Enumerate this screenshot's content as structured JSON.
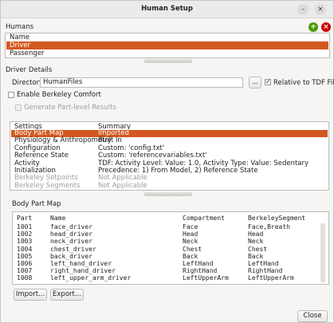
{
  "window": {
    "title": "Human Setup",
    "minimize_icon": "minimize-icon",
    "close_icon": "close-icon"
  },
  "humans": {
    "label": "Humans",
    "add_icon": "plus-icon",
    "remove_icon": "x-icon",
    "header": "Name",
    "items": [
      "Driver",
      "Passenger"
    ],
    "selected": "Driver",
    "colors": {
      "add": "#4e9a06",
      "remove": "#cc0000",
      "selection": "#d2581f"
    }
  },
  "details": {
    "label": "Driver Details",
    "directory_label": "Directory:",
    "directory_value": "HumanFiles",
    "browse_label": "...",
    "relative_label": "Relative to TDF File",
    "relative_checked": true,
    "berkeley_label": "Enable Berkeley Comfort",
    "berkeley_checked": false,
    "generate_label": "Generate Part-level Results",
    "generate_checked": false
  },
  "settings": {
    "headers": [
      "Settings",
      "Summary"
    ],
    "rows": [
      {
        "setting": "Body Part Map",
        "summary": "Imported",
        "selected": true,
        "disabled": false
      },
      {
        "setting": "Physiology & Anthropometry",
        "summary": "Built In",
        "selected": false,
        "disabled": false
      },
      {
        "setting": "Configuration",
        "summary": "Custom: 'config.txt'",
        "selected": false,
        "disabled": false
      },
      {
        "setting": "Reference State",
        "summary": "Custom: 'referencevariables.txt'",
        "selected": false,
        "disabled": false
      },
      {
        "setting": "Activity",
        "summary": "TDF: Activity Level: Value: 1.0, Activity Type: Value: Sedentary",
        "selected": false,
        "disabled": false
      },
      {
        "setting": "Initialization",
        "summary": "Precedence: 1) From Model, 2) Reference State",
        "selected": false,
        "disabled": false
      },
      {
        "setting": "Berkeley Setpoints",
        "summary": "Not Applicable",
        "selected": false,
        "disabled": true
      },
      {
        "setting": "Berkeley Segments",
        "summary": "Not Applicable",
        "selected": false,
        "disabled": true
      }
    ]
  },
  "body_part_map": {
    "label": "Body Part Map",
    "headers": [
      "Part",
      "Name",
      "Compartment",
      "BerkeleySegment"
    ],
    "rows": [
      [
        "1001",
        "face_driver",
        "Face",
        "Face,Breath"
      ],
      [
        "1002",
        "head_driver",
        "Head",
        "Head"
      ],
      [
        "1003",
        "neck_driver",
        "Neck",
        "Neck"
      ],
      [
        "1004",
        "chest_driver",
        "Chest",
        "Chest"
      ],
      [
        "1005",
        "back_driver",
        "Back",
        "Back"
      ],
      [
        "1006",
        "left_hand_driver",
        "LeftHand",
        "LeftHand"
      ],
      [
        "1007",
        "right_hand_driver",
        "RightHand",
        "RightHand"
      ],
      [
        "1008",
        "left_upper_arm_driver",
        "LeftUpperArm",
        "LeftUpperArm"
      ]
    ],
    "import_label": "Import...",
    "export_label": "Export..."
  },
  "footer": {
    "close_label": "Close"
  }
}
